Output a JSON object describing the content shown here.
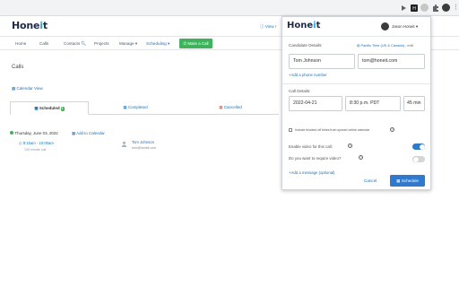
{
  "app": {
    "logo_text": "Hone",
    "logo_o": "i",
    "logo_tail": "t",
    "view_link": "View r"
  },
  "nav": {
    "home": "Home",
    "calls": "Calls",
    "contacts": "Contacts",
    "projects": "Projects",
    "manage": "Manage ▾",
    "scheduling": "Scheduling ▾",
    "make_call": "✆ Make a Call"
  },
  "page": {
    "title": "Calls",
    "calendar_view": "Calendar View"
  },
  "tabs": {
    "scheduled": "Scheduled",
    "scheduled_count": "1",
    "completed": "Completed",
    "cancelled": "Cancelled"
  },
  "schedule_list": {
    "day": "Thursday, June 03, 2022",
    "add_to_calendar": "Add to Calendar",
    "time": "8:15am - 10:00am",
    "duration": "105 minute call",
    "person_name": "Tom Johnson",
    "person_email": "tom@honeit.com"
  },
  "popup": {
    "logo_text": "Hone",
    "logo_o": "i",
    "logo_tail": "t",
    "user_name": "Jason Honeit ▾",
    "candidate_label": "Candidate Details:",
    "timezone": "Pacific Time (US & Canada)",
    "timezone_edit": "- edit",
    "name_value": "Tom Johnson",
    "email_value": "tom@honeit.com",
    "add_phone": "Add a phone number",
    "call_label": "Call Details:",
    "date_value": "2022-04-21",
    "time_value": "8:30 p.m. PDT",
    "duration_value": "45 min",
    "include_blocked": "Include blocked off times from synced online calendar",
    "enable_video": "Enable video for this call:",
    "require_video": "Do you want to require video?",
    "add_message": "Add a message (optional)",
    "cancel": "Cancel",
    "schedule": "Schedule",
    "video_enabled": true,
    "require_video_enabled": false
  },
  "colors": {
    "accent_blue": "#2b7bd4",
    "green": "#3cb55a",
    "toggle_off": "#d6d6d6"
  }
}
